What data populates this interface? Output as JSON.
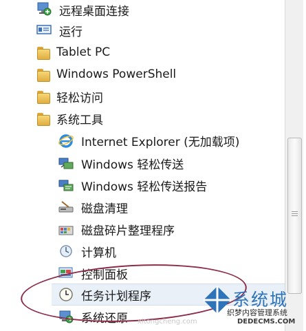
{
  "menu": {
    "items": [
      {
        "label": "远程桌面连接",
        "icon": "remote-desktop-icon"
      },
      {
        "label": "运行",
        "icon": "run-icon"
      },
      {
        "label": "Tablet PC",
        "icon": "folder-icon"
      },
      {
        "label": "Windows PowerShell",
        "icon": "folder-icon"
      },
      {
        "label": "轻松访问",
        "icon": "folder-icon"
      },
      {
        "label": "系统工具",
        "icon": "folder-icon"
      }
    ],
    "subitems": [
      {
        "label": "Internet Explorer (无加载项)",
        "icon": "internet-explorer-icon"
      },
      {
        "label": "Windows 轻松传送",
        "icon": "easy-transfer-icon"
      },
      {
        "label": "Windows 轻松传送报告",
        "icon": "easy-transfer-report-icon"
      },
      {
        "label": "磁盘清理",
        "icon": "disk-cleanup-icon"
      },
      {
        "label": "磁盘碎片整理程序",
        "icon": "defragmenter-icon"
      },
      {
        "label": "计算机",
        "icon": "computer-icon"
      },
      {
        "label": "控制面板",
        "icon": "control-panel-icon"
      },
      {
        "label": "任务计划程序",
        "icon": "clock-icon"
      },
      {
        "label": "系统还原",
        "icon": "system-restore-icon"
      }
    ]
  },
  "watermark": {
    "brand": "系统城",
    "tagline": "织梦内容管理系统",
    "url": "DEDECMS.COM",
    "small_url": "xitongcheng.com"
  },
  "colors": {
    "folder": "#e8b84a",
    "highlight_oval": "#8c2b47",
    "watermark_blue": "#2f74b8"
  }
}
